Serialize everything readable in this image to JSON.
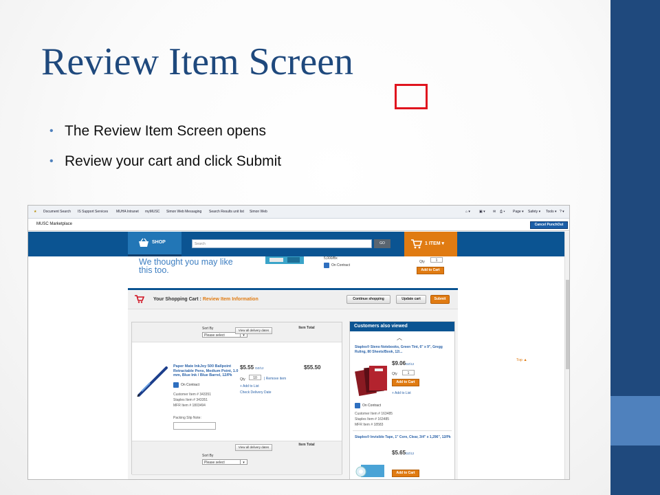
{
  "slide": {
    "title": "Review Item Screen",
    "bullets": [
      "The Review Item Screen opens",
      "Review your cart and click Submit"
    ]
  },
  "browser": {
    "favorites": [
      "Document Search",
      "IS Support Services",
      "MUHA Intranet",
      "myMUSC",
      "Simon Web Messaging",
      "Search Results unit list",
      "Simon Web"
    ],
    "tools": [
      "Page ▾",
      "Safety ▾",
      "Tools ▾"
    ],
    "app_title": "MUSC Marketplace",
    "cancel_label": "Cancel PunchOut"
  },
  "header": {
    "shop_label": "SHOP",
    "search_placeholder": "Search",
    "go_label": "GO",
    "cart_count_label": "1 ITEM"
  },
  "suggestion": {
    "headline": "We thought you may like this too.",
    "spec": "5,000/Bx",
    "on_contract": "On Contract",
    "qty_label": "Qty",
    "qty_value": "1",
    "add_label": "Add to Cart"
  },
  "cart_header": {
    "title": "Your Shopping Cart : ",
    "subtitle": "Review Item Information",
    "continue_label": "Continue shopping",
    "update_label": "Update cart",
    "submit_label": "Submit"
  },
  "cart": {
    "sort_label": "Sort By",
    "sort_value": "Please select",
    "view_dates_label": "View all delivery dates",
    "col_item_total": "Item Total",
    "item": {
      "name": "Paper Mate InkJoy 500 Ballpoint Retractable Pens, Medium Point, 1.0 mm, Blue Ink / Blue Barrel, 12/Pk",
      "price": "$5.55",
      "price_unit": "DZ/12",
      "total": "$55.50",
      "qty_label": "Qty",
      "qty": "10",
      "remove_label": "Remove item",
      "add_list_label": "+ Add to List",
      "check_delivery_label": "Check Delivery Date",
      "on_contract": "On Contract",
      "customer_item": "Customer Item # 343351",
      "staples_item": "Staples Item # 343351",
      "mfr_item": "MFR Item # 1803494",
      "packing_label": "Packing Slip Note:"
    }
  },
  "sidebar": {
    "title": "Customers also viewed",
    "p1": {
      "name": "Staples® Steno Notebooks, Green Tint, 6\" x 9\", Gregg Ruling, 80 Sheets/Book, 12/...",
      "price": "$9.06",
      "unit": "DZ/12",
      "qty_label": "Qty",
      "qty": "1",
      "add_label": "Add to Cart",
      "add_list": "+ Add to List",
      "on_contract": "On Contract",
      "customer_item": "Customer Item # 163485",
      "staples_item": "Staples Item # 163485",
      "mfr_item": "MFR Item # 18583"
    },
    "p2": {
      "name": "Staples® Invisible Tape, 1\" Core, Clear, 3/4\" x 1,296\", 12/Pk",
      "price": "$5.65",
      "unit": "DZ/12",
      "add_label": "Add to Cart"
    }
  },
  "top_link": "Top ▲",
  "colors": {
    "slide_blue": "#1f497d",
    "accent_blue": "#4f81bd",
    "header_blue": "#0b5492",
    "orange": "#e07b12",
    "highlight_red": "#e0141e"
  }
}
